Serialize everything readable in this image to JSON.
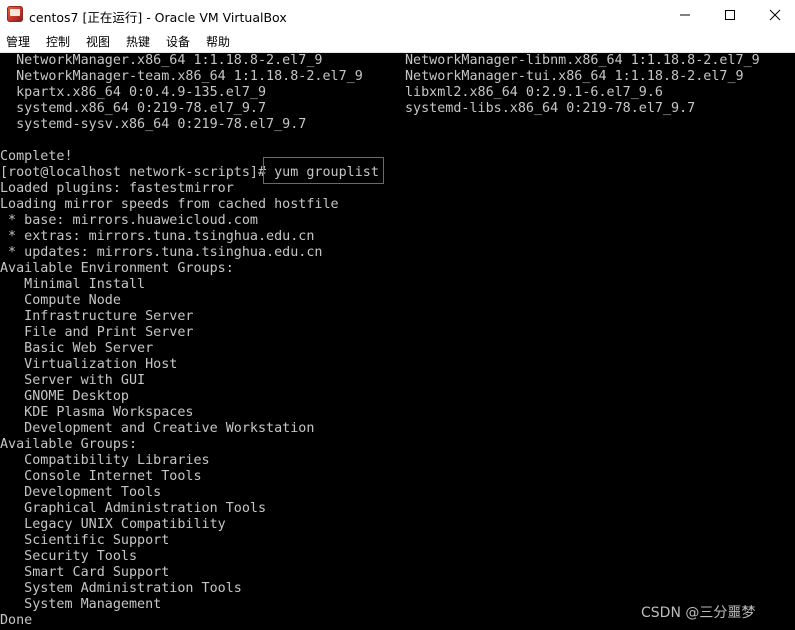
{
  "window": {
    "title": "centos7 [正在运行] - Oracle VM VirtualBox",
    "icon": "virtualbox-app-icon",
    "controls": {
      "minimize": "minimize-icon",
      "maximize": "maximize-icon",
      "close": "close-icon"
    }
  },
  "menu": {
    "items": [
      {
        "label": "管理"
      },
      {
        "label": "控制"
      },
      {
        "label": "视图"
      },
      {
        "label": "热键"
      },
      {
        "label": "设备"
      },
      {
        "label": "帮助"
      }
    ]
  },
  "console": {
    "background": "#000000",
    "foreground": "#c6c6c6",
    "highlight_color": "#e0392f",
    "lines": [
      "  NetworkManager.x86_64 1:1.18.8-2.el7_9",
      "  NetworkManager-team.x86_64 1:1.18.8-2.el7_9",
      "  kpartx.x86_64 0:0.4.9-135.el7_9",
      "  systemd.x86_64 0:219-78.el7_9.7",
      "  systemd-sysv.x86_64 0:219-78.el7_9.7",
      "",
      "Complete!",
      "[root@localhost network-scripts]# yum grouplist",
      "Loaded plugins: fastestmirror",
      "Loading mirror speeds from cached hostfile",
      " * base: mirrors.huaweicloud.com",
      " * extras: mirrors.tuna.tsinghua.edu.cn",
      " * updates: mirrors.tuna.tsinghua.edu.cn",
      "Available Environment Groups:",
      "   Minimal Install",
      "   Compute Node",
      "   Infrastructure Server",
      "   File and Print Server",
      "   Basic Web Server",
      "   Virtualization Host",
      "   Server with GUI",
      "   GNOME Desktop",
      "   KDE Plasma Workspaces",
      "   Development and Creative Workstation",
      "Available Groups:",
      "   Compatibility Libraries",
      "   Console Internet Tools",
      "   Development Tools",
      "   Graphical Administration Tools",
      "   Legacy UNIX Compatibility",
      "   Scientific Support",
      "   Security Tools",
      "   Smart Card Support",
      "   System Administration Tools",
      "   System Management",
      "Done"
    ],
    "right_column": [
      "NetworkManager-libnm.x86_64 1:1.18.8-2.el7_9",
      "NetworkManager-tui.x86_64 1:1.18.8-2.el7_9",
      "libxml2.x86_64 0:2.9.1-6.el7_9.6",
      "systemd-libs.x86_64 0:219-78.el7_9.7"
    ]
  },
  "watermark": "CSDN @三分噩梦"
}
